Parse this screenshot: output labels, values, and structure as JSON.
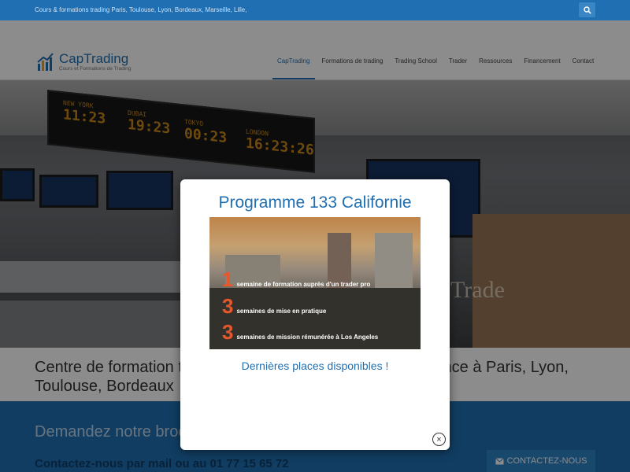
{
  "topbar": {
    "tagline": "Cours & formations trading Paris, Toulouse, Lyon, Bordeaux, Marseille, Lille,",
    "search_icon": "search-icon"
  },
  "header": {
    "logo_name": "CapTrading",
    "logo_sub": "Cours et Formations de Trading",
    "nav": [
      {
        "label": "CapTrading"
      },
      {
        "label": "Formations de trading"
      },
      {
        "label": "Trading School"
      },
      {
        "label": "Trader"
      },
      {
        "label": "Ressources"
      },
      {
        "label": "Financement"
      },
      {
        "label": "Contact"
      }
    ]
  },
  "hero": {
    "clocks": [
      {
        "city": "NEW YORK",
        "time": "11:23"
      },
      {
        "city": "DUBAI",
        "time": "19:23"
      },
      {
        "city": "TOKYO",
        "time": "00:23"
      },
      {
        "city": "LONDON",
        "time": "16:23:26"
      }
    ],
    "brand": "Trade"
  },
  "intro": {
    "text": "Centre de formation trading et finance de marché d'excellence à Paris, Lyon, Toulouse, Bordeaux"
  },
  "cta": {
    "title": "Demandez notre brochure",
    "contact": "Contactez-nous par mail ou au 01 77 15 65 72",
    "button": "CONTACTEZ-NOUS",
    "button_icon": "envelope-icon"
  },
  "modal": {
    "title": "Programme 133 Californie",
    "promo_lines": [
      {
        "num": "1",
        "text": "semaine de formation auprès d'un trader pro"
      },
      {
        "num": "3",
        "text": "semaines de mise en pratique"
      },
      {
        "num": "3",
        "text": "semaines de mission rémunérée à Los Angeles"
      }
    ],
    "link": "Dernières places disponibles !",
    "close": "×"
  },
  "colors": {
    "brand_blue": "#1f6fb2",
    "accent_orange": "#e8572b"
  }
}
